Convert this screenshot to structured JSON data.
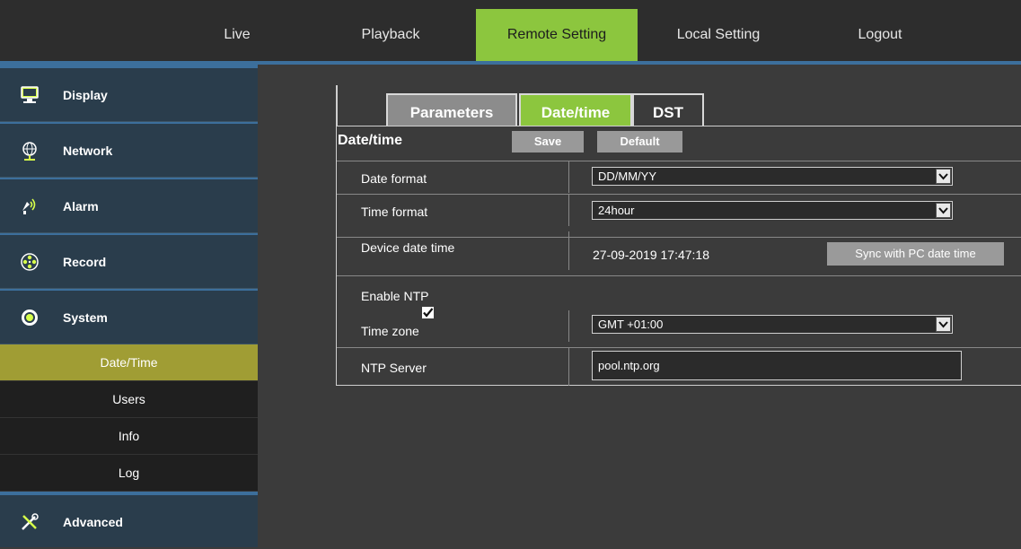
{
  "nav": {
    "items": [
      {
        "label": "Live",
        "active": false
      },
      {
        "label": "Playback",
        "active": false
      },
      {
        "label": "Remote Setting",
        "active": true
      },
      {
        "label": "Local Setting",
        "active": false
      },
      {
        "label": "Logout",
        "active": false
      }
    ]
  },
  "sidebar": {
    "items": [
      {
        "label": "Display",
        "icon": "monitor-icon"
      },
      {
        "label": "Network",
        "icon": "globe-icon"
      },
      {
        "label": "Alarm",
        "icon": "alarm-icon"
      },
      {
        "label": "Record",
        "icon": "film-reel-icon"
      },
      {
        "label": "System",
        "icon": "gear-icon"
      }
    ],
    "sub_items": [
      {
        "label": "Date/Time",
        "active": true
      },
      {
        "label": "Users",
        "active": false
      },
      {
        "label": "Info",
        "active": false
      },
      {
        "label": "Log",
        "active": false
      }
    ],
    "advanced": {
      "label": "Advanced",
      "icon": "tools-icon"
    }
  },
  "tabs": {
    "items": [
      {
        "label": "Parameters",
        "active": false
      },
      {
        "label": "Date/time",
        "active": true
      },
      {
        "label": "DST",
        "active": false
      }
    ]
  },
  "panel": {
    "title": "Date/time",
    "save_label": "Save",
    "default_label": "Default",
    "date_format": {
      "label": "Date format",
      "value": "DD/MM/YY"
    },
    "time_format": {
      "label": "Time format",
      "value": "24hour"
    },
    "device_date_time": {
      "label": "Device date time",
      "value": "27-09-2019 17:47:18",
      "sync_label": "Sync with PC date time"
    },
    "enable_ntp": {
      "label": "Enable NTP",
      "checked": true
    },
    "time_zone": {
      "label": "Time zone",
      "value": "GMT +01:00"
    },
    "ntp_server": {
      "label": "NTP Server",
      "value": "pool.ntp.org"
    }
  },
  "colors": {
    "accent_green": "#8cc63e",
    "active_sub_item": "#a09d34",
    "sidebar_bg": "#2a3d4c",
    "blue_border": "#3c6f9c"
  }
}
